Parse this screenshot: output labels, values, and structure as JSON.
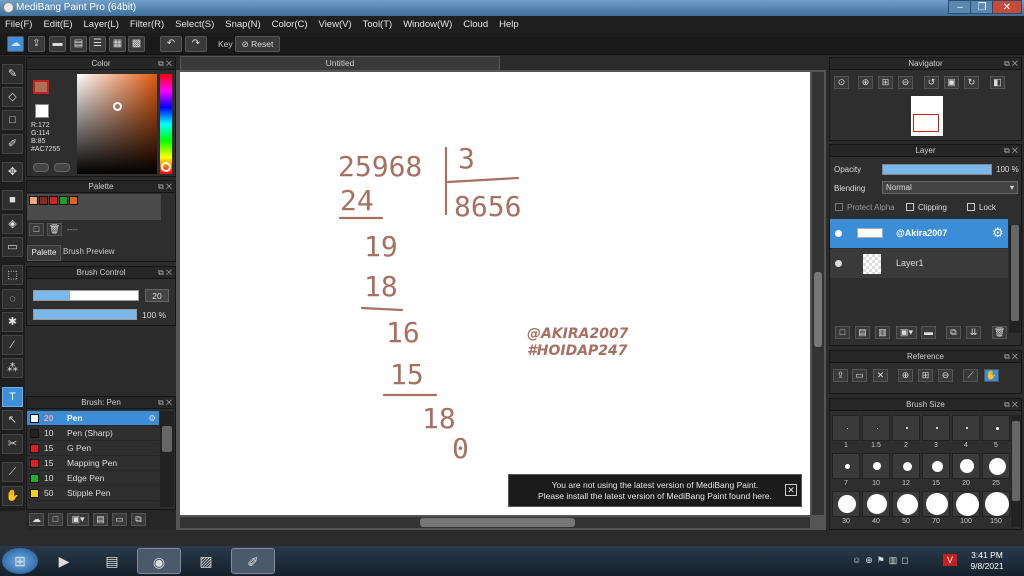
{
  "app": {
    "title": "MediBang Paint Pro (64bit)"
  },
  "menu": [
    "File(F)",
    "Edit(E)",
    "Layer(L)",
    "Filter(R)",
    "Select(S)",
    "Snap(N)",
    "Color(C)",
    "View(V)",
    "Tool(T)",
    "Window(W)",
    "Cloud",
    "Help"
  ],
  "toolbar": {
    "key_label": "Key",
    "reset_label": "Reset"
  },
  "color_panel": {
    "title": "Color",
    "r": "R:172",
    "g": "G:114",
    "b": "B:85",
    "hex": "#AC7255",
    "accent": "#ac7255"
  },
  "palette_panel": {
    "title": "Palette",
    "tab_palette": "Palette",
    "tab_preview": "Brush Preview",
    "dashes": "----",
    "swatches": [
      "#f0a878",
      "#8a2b1a",
      "#d42020",
      "#20a020",
      "#e06020"
    ]
  },
  "brush_control": {
    "title": "Brush Control",
    "size": "20",
    "opacity": "100 %",
    "size_fraction": 0.35,
    "opacity_fraction": 1.0
  },
  "brush_list": {
    "title": "Brush: Pen",
    "items": [
      {
        "size": "20",
        "name": "Pen",
        "color": "#ffffff"
      },
      {
        "size": "10",
        "name": "Pen (Sharp)",
        "color": "#222222"
      },
      {
        "size": "15",
        "name": "G Pen",
        "color": "#e02020"
      },
      {
        "size": "15",
        "name": "Mapping Pen",
        "color": "#e02020"
      },
      {
        "size": "10",
        "name": "Edge Pen",
        "color": "#20b020"
      },
      {
        "size": "50",
        "name": "Stipple Pen",
        "color": "#f0d020"
      }
    ]
  },
  "document": {
    "tab": "Untitled"
  },
  "drawing": {
    "dividend": "25968",
    "divisor": "3",
    "quotient": "8656",
    "steps": [
      "24",
      "19",
      "18",
      "16",
      "15",
      "18",
      "0"
    ],
    "watermark1": "@AKIRA2007",
    "watermark2": "#HOIDAP247"
  },
  "notice": {
    "line1": "You are not using the latest version of MediBang Paint.",
    "line2": "Please install the latest version of MediBang Paint found here."
  },
  "navigator": {
    "title": "Navigator"
  },
  "layer_panel": {
    "title": "Layer",
    "opacity_label": "Opacity",
    "opacity_value": "100 %",
    "opacity_fraction": 1.0,
    "blending_label": "Blending",
    "blending_value": "Normal",
    "protect_alpha": "Protect Alpha",
    "clipping": "Clipping",
    "lock": "Lock",
    "layers": [
      {
        "name": "@Akira2007",
        "selected": true
      },
      {
        "name": "Layer1",
        "selected": false
      }
    ]
  },
  "reference": {
    "title": "Reference"
  },
  "brush_size": {
    "title": "Brush Size",
    "sizes": [
      "1",
      "1.5",
      "2",
      "3",
      "4",
      "5",
      "7",
      "10",
      "12",
      "15",
      "20",
      "25",
      "30",
      "40",
      "50",
      "70",
      "100",
      "150"
    ]
  },
  "taskbar": {
    "time": "3:41 PM",
    "date": "9/8/2021"
  }
}
